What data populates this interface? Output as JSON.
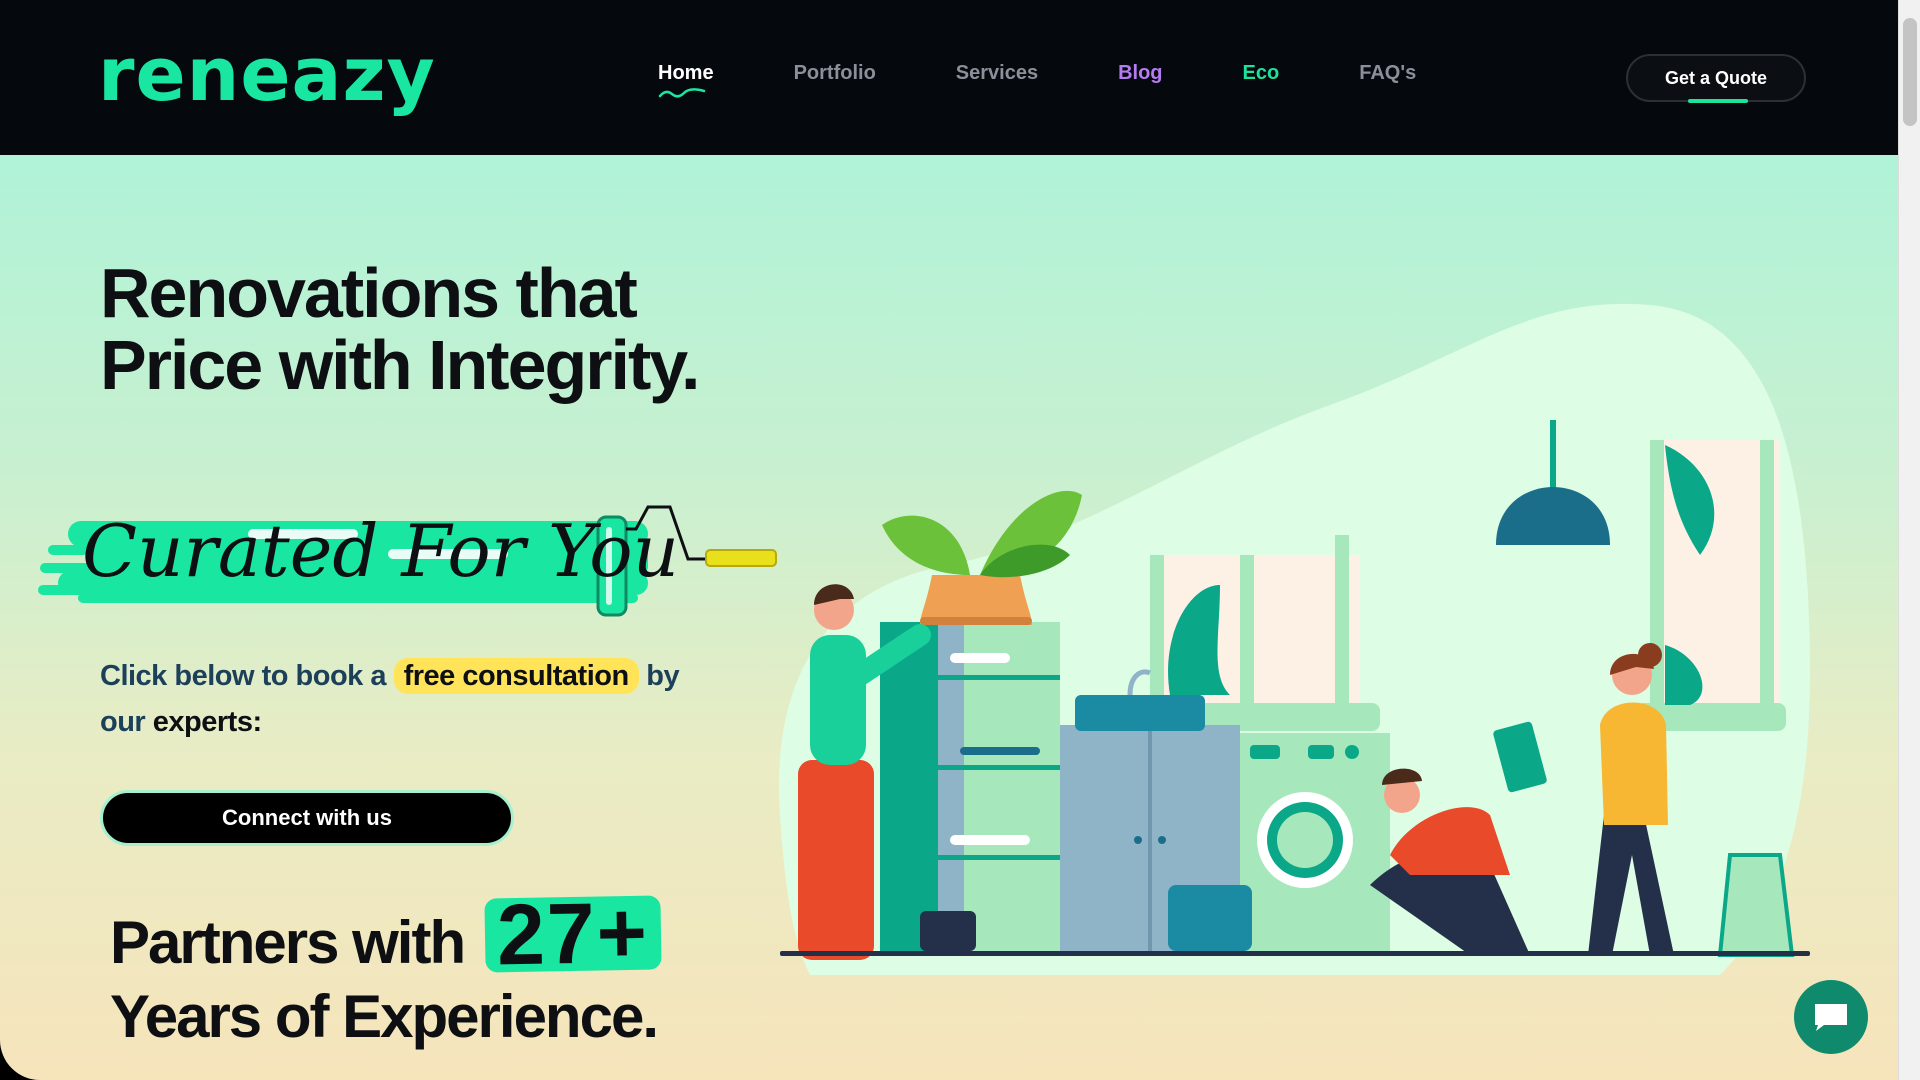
{
  "header": {
    "logo_text": "reneazy",
    "nav": [
      {
        "label": "Home",
        "active": true
      },
      {
        "label": "Portfolio"
      },
      {
        "label": "Services"
      },
      {
        "label": "Blog"
      },
      {
        "label": "Eco"
      },
      {
        "label": "FAQ's"
      }
    ],
    "quote_button": "Get a Quote"
  },
  "hero": {
    "headline_line1": "Renovations that",
    "headline_line2": "Price with Integrity.",
    "brush_text": "Curated For You",
    "cta_part1": "Click below to book a",
    "cta_highlight": "free consultation",
    "cta_part2": "by",
    "cta_part3": "our",
    "cta_part4": "experts:",
    "connect_button": "Connect with us",
    "partners_prefix": "Partners with",
    "partners_number": "27+",
    "partners_suffix": "Years of Experience."
  },
  "colors": {
    "brand_green": "#19e6a1",
    "header_bg": "#05080d",
    "highlight_yellow": "#ffe45a",
    "blog_purple": "#b57cf0"
  },
  "icons": {
    "chat": "chat-bubble-icon",
    "nav_underline": "squiggle-underline-icon"
  }
}
